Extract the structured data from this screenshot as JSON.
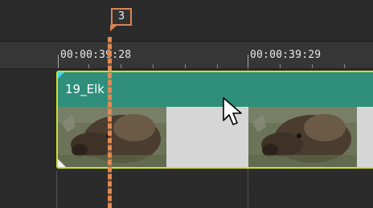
{
  "marker": {
    "label": "3"
  },
  "ruler": {
    "timecodes": [
      "00:00:39:28",
      "00:00:39:29"
    ]
  },
  "clip": {
    "title": "19_Elk"
  },
  "colors": {
    "clip_header": "#2f8f7b",
    "clip_border": "#cde030",
    "playhead": "#e08a55",
    "background": "#2f2f2f"
  },
  "icons": {
    "cursor": "mouse-pointer-icon",
    "marker": "marker-flag-icon"
  }
}
